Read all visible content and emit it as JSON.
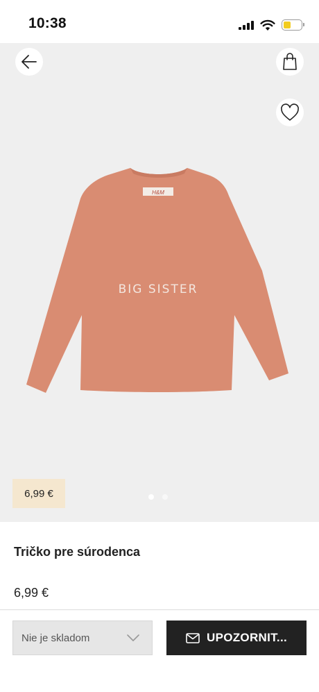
{
  "status_bar": {
    "time": "10:38",
    "battery_level": 0.4,
    "battery_color": "#f2cc1f",
    "icons": [
      "signal-icon",
      "wifi-icon",
      "battery-icon"
    ]
  },
  "hero": {
    "back_icon": "arrow-left-icon",
    "bag_icon": "shopping-bag-icon",
    "favorite_icon": "heart-icon",
    "shirt_print": "BIG SISTER",
    "shirt_color": "#d98c72",
    "price_badge": "6,99 €",
    "price_badge_color": "#f5e7cf",
    "carousel": {
      "count": 2,
      "active": 1
    }
  },
  "product": {
    "title": "Tričko pre súrodenca",
    "price": "6,99 €"
  },
  "actions": {
    "stock_label": "Nie je skladom",
    "notify_label": "UPOZORNIT...",
    "notify_icon": "envelope-icon",
    "select_icon": "chevron-down-icon"
  }
}
